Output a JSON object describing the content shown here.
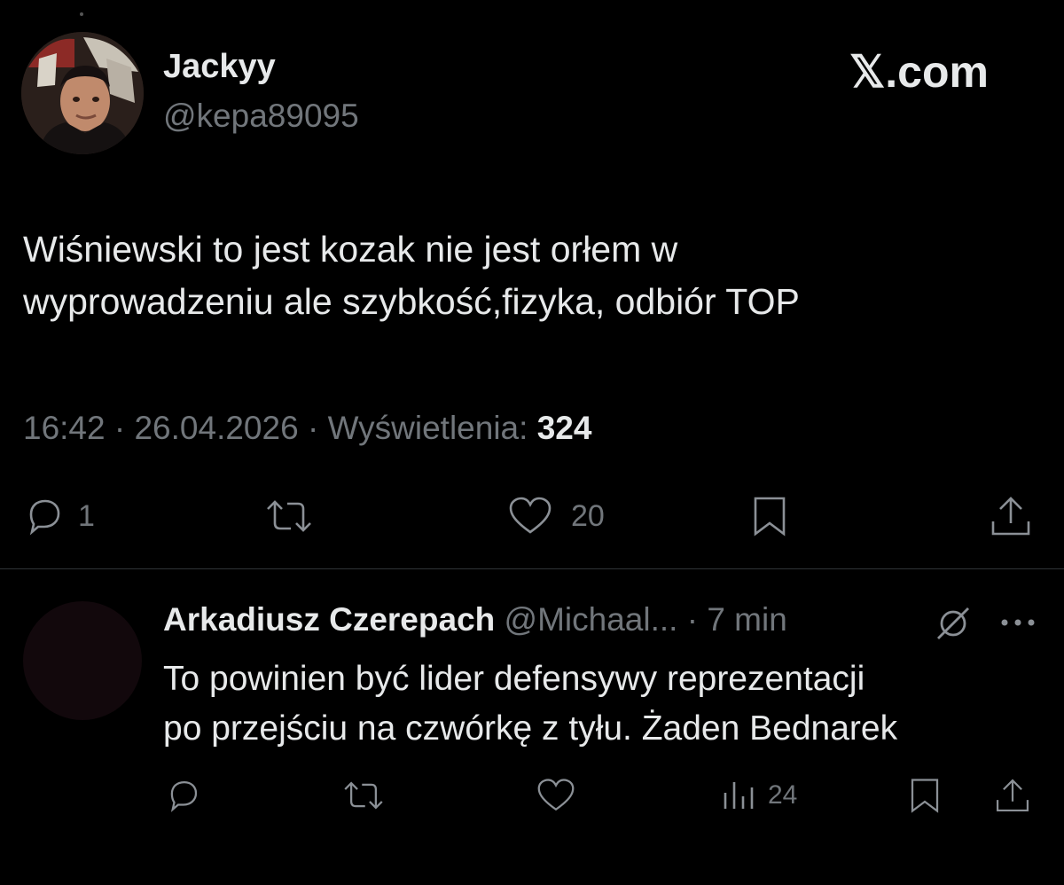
{
  "brand": {
    "logo_text": "𝕏.com"
  },
  "tweet": {
    "author_name": "Jackyy",
    "author_handle": "@kepa89095",
    "text_line1": "Wiśniewski to jest kozak nie jest orłem w",
    "text_line2": "wyprowadzeniu ale szybkość,fizyka, odbiór TOP",
    "time": "16:42",
    "separator": "·",
    "date": "26.04.2026",
    "views_label": "Wyświetlenia:",
    "views_count": "324",
    "actions": {
      "reply_icon": "reply-bubble-icon",
      "reply_count": "1",
      "retweet_icon": "retweet-icon",
      "like_icon": "heart-icon",
      "like_count": "20",
      "bookmark_icon": "bookmark-icon",
      "share_icon": "share-icon"
    }
  },
  "reply": {
    "author_name": "Arkadiusz Czerepach",
    "author_handle": "@Michaal...",
    "separator": "·",
    "time": "7 min",
    "text_line1": "To powinien być lider defensywy reprezentacji",
    "text_line2": "po przejściu na czwórkę z tyłu. Żaden Bednarek",
    "actions": {
      "reply_icon": "reply-bubble-icon",
      "retweet_icon": "retweet-icon",
      "like_icon": "heart-icon",
      "views_icon": "views-chart-icon",
      "views_count": "24",
      "bookmark_icon": "bookmark-icon",
      "share_icon": "share-icon"
    },
    "grok_icon": "grok-icon",
    "more_icon": "more-options-icon"
  },
  "colors": {
    "background": "#000000",
    "primary_text": "#e7e9ea",
    "secondary_text": "#71767b",
    "divider": "#2f3336"
  }
}
